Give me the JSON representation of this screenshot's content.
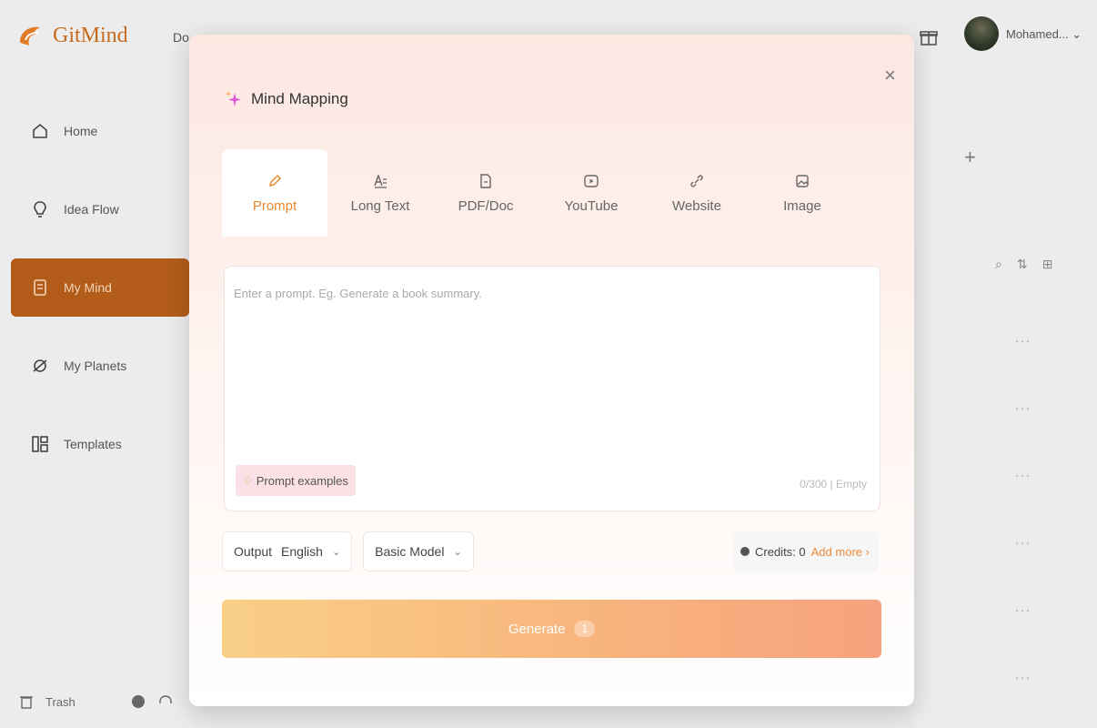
{
  "app": {
    "name": "GitMind",
    "top_nav_text": "Do",
    "user_name": "Mohamed...",
    "user_chevron": "⌄"
  },
  "sidebar": {
    "items": [
      {
        "label": "Home",
        "icon": "home-icon"
      },
      {
        "label": "Idea Flow",
        "icon": "bulb-icon"
      },
      {
        "label": "My Mind",
        "icon": "doc-icon",
        "active": true
      },
      {
        "label": "My Planets",
        "icon": "planet-icon"
      },
      {
        "label": "Templates",
        "icon": "templates-icon"
      }
    ],
    "footer_trash": "Trash"
  },
  "right_pane": {
    "plus": "+",
    "dots": "···"
  },
  "modal": {
    "title": "Mind Mapping",
    "close": "×",
    "tabs": [
      {
        "label": "Prompt",
        "icon": "pen-icon",
        "active": true
      },
      {
        "label": "Long Text",
        "icon": "text-icon"
      },
      {
        "label": "PDF/Doc",
        "icon": "file-icon"
      },
      {
        "label": "YouTube",
        "icon": "youtube-icon"
      },
      {
        "label": "Website",
        "icon": "link-icon"
      },
      {
        "label": "Image",
        "icon": "image-icon"
      }
    ],
    "prompt_placeholder": "Enter a prompt. Eg. Generate a book summary.",
    "prompt_value": "",
    "examples_label": "Prompt examples",
    "counter": "0/300 | Empty",
    "output_label": "Output",
    "language": "English",
    "model": "Basic Model",
    "credits_label": "Credits: 0",
    "add_more": "Add more ›",
    "generate_label": "Generate",
    "generate_cost": "1"
  },
  "colors": {
    "brand": "#c86a1d",
    "active_sidebar": "#b35c1a",
    "accent": "#e7892e"
  }
}
